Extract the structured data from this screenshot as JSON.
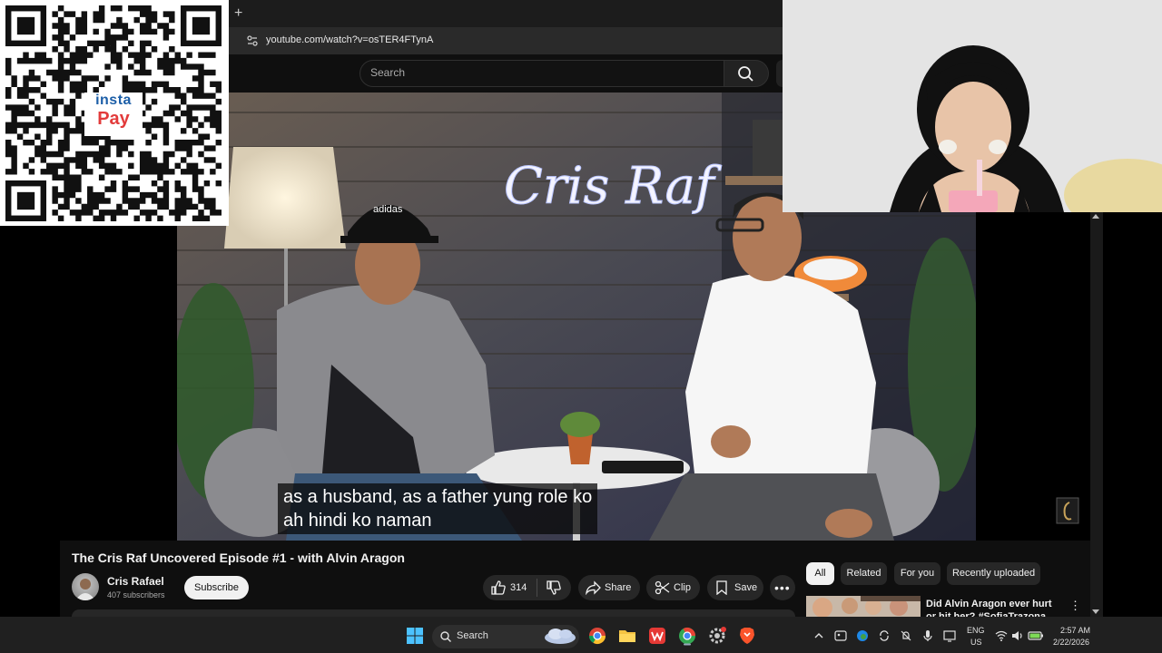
{
  "browser": {
    "new_tab": "+",
    "url": "youtube.com/watch?v=osTER4FTynA"
  },
  "youtube": {
    "search_placeholder": "Search",
    "video": {
      "neon_sign": "Cris Raf",
      "cap_brand": "adidas",
      "caption_line1": "as a husband, as a father yung role ko",
      "caption_line2": "ah hindi ko naman"
    },
    "title": "The Cris Raf Uncovered Episode #1 - with Alvin Aragon",
    "channel": {
      "name": "Cris Rafael",
      "subscribers": "407 subscribers",
      "subscribe_label": "Subscribe"
    },
    "actions": {
      "likes": "314",
      "share": "Share",
      "clip": "Clip",
      "save": "Save",
      "more": "•••"
    },
    "chips": [
      "All",
      "Related",
      "For you",
      "Recently uploaded"
    ],
    "recommendation": {
      "title": "Did Alvin Aragon ever hurt or hit her? #SofiaTrazona #Izzy"
    }
  },
  "qr_overlay": {
    "logo_line1": "insta",
    "logo_line2": "Pay"
  },
  "taskbar": {
    "search_label": "Search",
    "language": "ENG",
    "region": "US",
    "time": "2:57 AM",
    "date": "2/22/2026"
  },
  "colors": {
    "youtube_bg": "#0f0f0f",
    "chip_active": "#f1f1f1",
    "pill": "#272727",
    "brave": "#fb542b"
  }
}
